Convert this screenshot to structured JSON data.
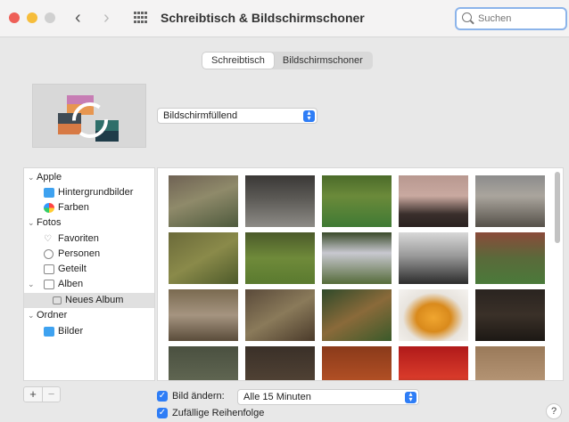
{
  "window": {
    "title": "Schreibtisch & Bildschirmschoner",
    "search_placeholder": "Suchen"
  },
  "tabs": [
    {
      "label": "Schreibtisch",
      "active": true
    },
    {
      "label": "Bildschirmschoner",
      "active": false
    }
  ],
  "preview": {
    "fit_mode": "Bildschirmfüllend"
  },
  "sidebar": {
    "sections": [
      {
        "label": "Apple",
        "items": [
          {
            "label": "Hintergrundbilder",
            "icon": "folder-icon"
          },
          {
            "label": "Farben",
            "icon": "color-wheel-icon"
          }
        ]
      },
      {
        "label": "Fotos",
        "items": [
          {
            "label": "Favoriten",
            "icon": "heart-icon"
          },
          {
            "label": "Personen",
            "icon": "person-icon"
          },
          {
            "label": "Geteilt",
            "icon": "shared-icon"
          },
          {
            "label": "Alben",
            "icon": "album-icon"
          },
          {
            "label": "Neues Album",
            "icon": "album-icon",
            "selected": true
          }
        ]
      },
      {
        "label": "Ordner",
        "items": [
          {
            "label": "Bilder",
            "icon": "folder-icon"
          }
        ]
      }
    ],
    "add_label": "+",
    "remove_label": "−"
  },
  "options": {
    "change_picture": {
      "label": "Bild ändern:",
      "checked": true
    },
    "interval": "Alle 15 Minuten",
    "random_order": {
      "label": "Zufällige Reihenfolge",
      "checked": true
    }
  },
  "colors": {
    "accent": "#2e7df6",
    "window_bg": "#e8e8e8"
  }
}
